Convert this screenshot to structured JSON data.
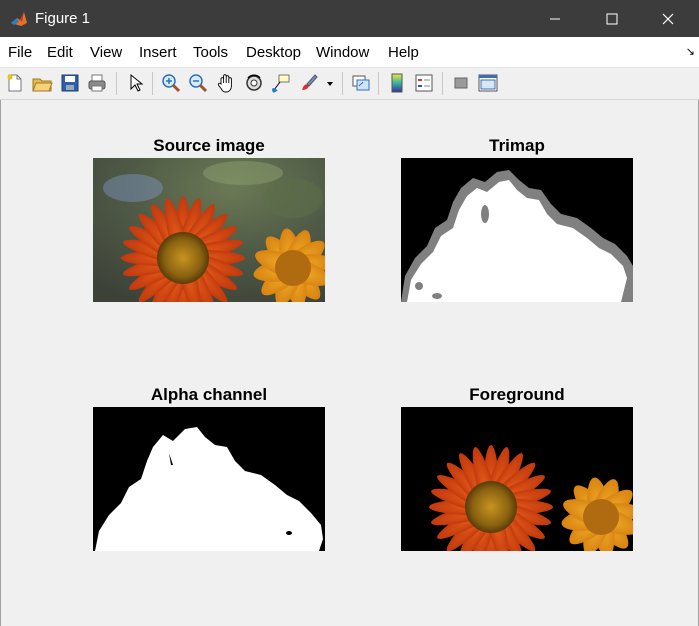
{
  "window": {
    "title": "Figure 1",
    "controls": {
      "minimize": "—",
      "maximize": "☐",
      "close": "✕"
    }
  },
  "menu": {
    "items": [
      {
        "label": "File"
      },
      {
        "label": "Edit"
      },
      {
        "label": "View"
      },
      {
        "label": "Insert"
      },
      {
        "label": "Tools"
      },
      {
        "label": "Desktop"
      },
      {
        "label": "Window"
      },
      {
        "label": "Help"
      }
    ]
  },
  "toolbar": {
    "icons": [
      "new-figure-icon",
      "open-file-icon",
      "save-icon",
      "print-icon",
      "select-arrow-icon",
      "zoom-in-icon",
      "zoom-out-icon",
      "pan-hand-icon",
      "rotate-3d-icon",
      "data-cursor-icon",
      "brush-icon",
      "brush-dropdown-icon",
      "link-plot-icon",
      "colorbar-icon",
      "legend-icon",
      "hide-plot-tools-icon",
      "show-plot-tools-icon"
    ]
  },
  "figure": {
    "panels": [
      {
        "title": "Source image"
      },
      {
        "title": "Trimap"
      },
      {
        "title": "Alpha channel"
      },
      {
        "title": "Foreground"
      }
    ]
  },
  "colors": {
    "titlebar": "#3c3c3c",
    "menubar": "#ffffff",
    "figure_bg": "#f0f0f0",
    "trimap_unknown": "#808080",
    "petal_orange": "#e0541a",
    "petal_yellow": "#f0a020",
    "flower_center": "#c89420"
  }
}
